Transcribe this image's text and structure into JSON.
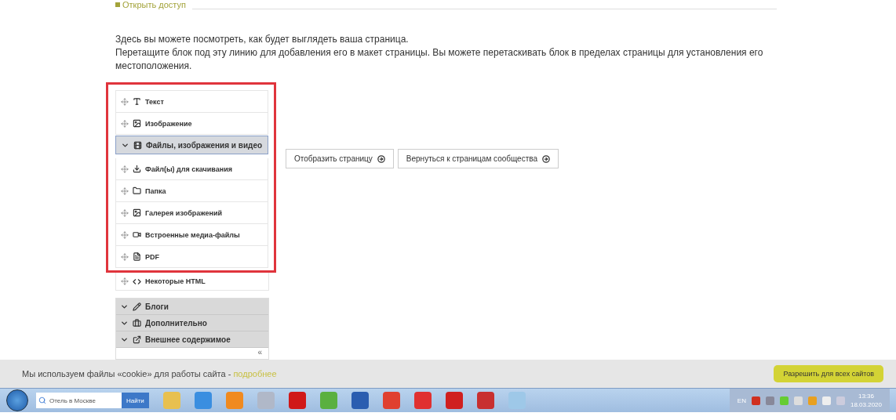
{
  "top_tab": {
    "label": "Открыть доступ"
  },
  "intro": [
    "Здесь вы можете посмотреть, как будет выглядеть ваша страница.",
    "Перетащите блок под эту линию для добавления его в макет страницы. Вы можете перетаскивать блок в пределах страницы для установления его местоположения."
  ],
  "palette": {
    "highlighted": [
      {
        "kind": "item",
        "label": "Текст"
      },
      {
        "kind": "item",
        "label": "Изображение"
      },
      {
        "kind": "group",
        "label": "Файлы, изображения и видео",
        "expanded": true
      },
      {
        "kind": "item",
        "label": "Файл(ы) для скачивания"
      },
      {
        "kind": "item",
        "label": "Папка"
      },
      {
        "kind": "item",
        "label": "Галерея изображений"
      },
      {
        "kind": "item",
        "label": "Встроенные медиа-файлы"
      },
      {
        "kind": "item",
        "label": "PDF"
      }
    ],
    "extra_items": [
      {
        "label": "Некоторые HTML"
      }
    ],
    "groups": [
      {
        "label": "Блоги",
        "expanded": false
      },
      {
        "label": "Дополнительно",
        "expanded": false
      },
      {
        "label": "Внешнее содержимое",
        "expanded": false
      }
    ],
    "collapse": "«"
  },
  "buttons": [
    {
      "label": "Отобразить страницу"
    },
    {
      "label": "Вернуться к страницам сообщества"
    }
  ],
  "cookie_bar": {
    "text": "Мы используем файлы «cookie» для работы сайта - ",
    "link": "подробнее",
    "button": "Разрешить для всех сайтов"
  },
  "taskbar": {
    "search_value": "Отель в Москве",
    "search_button": "Найти",
    "language": "EN",
    "time": "13:36",
    "date": "18.03.2020"
  }
}
